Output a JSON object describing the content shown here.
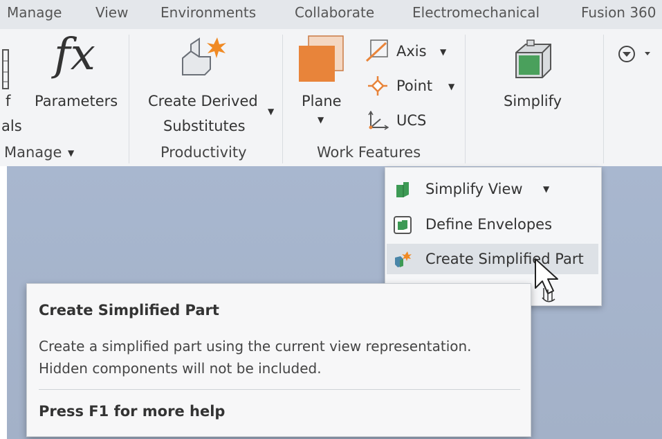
{
  "tabs": [
    "Manage",
    "View",
    "Environments",
    "Collaborate",
    "Electromechanical",
    "Fusion 360"
  ],
  "ribbon": {
    "partial_left": [
      "f",
      "als"
    ],
    "parameters_label": "Parameters",
    "manage_group": "Manage",
    "create_derived_line1": "Create Derived",
    "create_derived_line2": "Substitutes",
    "productivity_group": "Productivity",
    "plane_label": "Plane",
    "axis_label": "Axis",
    "point_label": "Point",
    "ucs_label": "UCS",
    "work_features_group": "Work Features",
    "simplify_label": "Simplify",
    "fx_glyph": "fx"
  },
  "menu": {
    "items": [
      {
        "label": "Simplify View",
        "icon": "simplify-view-icon",
        "has_dropdown": true
      },
      {
        "label": "Define Envelopes",
        "icon": "define-envelopes-icon"
      },
      {
        "label": "Create Simplified Part",
        "icon": "create-simplified-part-icon",
        "hovered": true
      }
    ]
  },
  "tooltip": {
    "title": "Create Simplified Part",
    "description": "Create a simplified part using the current view representation. Hidden components will not be included.",
    "help": "Press F1 for more help"
  },
  "colors": {
    "accent_orange": "#e8843a",
    "simplify_green": "#4aa05c",
    "viewport": "#a8b7cf"
  }
}
